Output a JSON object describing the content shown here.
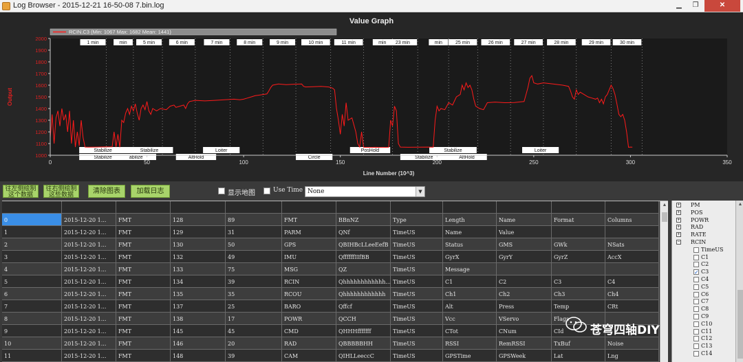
{
  "window": {
    "title": "Log Browser - 2015-12-21 16-50-08 7.bin.log",
    "min_glyph": "▁",
    "max_glyph": "❐",
    "close_glyph": "✕"
  },
  "graph": {
    "title": "Value Graph",
    "legend": "RCIN.C3 (Min: 1067 Max: 1682 Mean: 1441)",
    "ylabel": "Output",
    "xlabel": "Line Number (10^3)",
    "series_color": "#ff1a1a",
    "y_ticks": [
      "1000",
      "1100",
      "1200",
      "1300",
      "1400",
      "1500",
      "1600",
      "1700",
      "1800",
      "1900",
      "2000"
    ],
    "x_ticks": [
      "0",
      "50",
      "100",
      "150",
      "200",
      "250",
      "300",
      "350"
    ],
    "time_labels": [
      {
        "text": "1 min",
        "x": 29
      },
      {
        "text": "min",
        "x": 43
      },
      {
        "text": "5 min",
        "x": 58
      },
      {
        "text": "6 min",
        "x": 75
      },
      {
        "text": "7 min",
        "x": 93
      },
      {
        "text": "8 min",
        "x": 110
      },
      {
        "text": "9 min",
        "x": 127
      },
      {
        "text": "10 min",
        "x": 145
      },
      {
        "text": "11 min",
        "x": 162
      },
      {
        "text": "min",
        "x": 177
      },
      {
        "text": "23 min",
        "x": 190
      },
      {
        "text": "min",
        "x": 206
      },
      {
        "text": "25 min",
        "x": 221
      },
      {
        "text": "26 min",
        "x": 238
      },
      {
        "text": "27 min",
        "x": 255
      },
      {
        "text": "28 min",
        "x": 272
      },
      {
        "text": "29 min",
        "x": 290
      },
      {
        "text": "30 min",
        "x": 306
      }
    ],
    "modes_row1": [
      {
        "text": "Stabilize",
        "x": 15
      },
      {
        "text": "Stabilize",
        "x": 39
      },
      {
        "text": "Loiter",
        "x": 79
      },
      {
        "text": "PosHold",
        "x": 155
      },
      {
        "text": "Stabilize",
        "x": 196
      },
      {
        "text": "Loiter",
        "x": 244
      }
    ],
    "modes_row2": [
      {
        "text": "Stabilize",
        "x": 15
      },
      {
        "text": "abilize",
        "x": 34
      },
      {
        "text": "AltHold",
        "x": 65
      },
      {
        "text": "Circle",
        "x": 127
      },
      {
        "text": "Stabilize",
        "x": 181
      },
      {
        "text": "AltHold",
        "x": 205
      }
    ]
  },
  "chart_data": {
    "type": "line",
    "title": "Value Graph",
    "xlabel": "Line Number (10^3)",
    "ylabel": "Output",
    "xlim": [
      0,
      350
    ],
    "ylim": [
      1000,
      2000
    ],
    "grid": false,
    "legend_position": "top-left",
    "series": [
      {
        "name": "RCIN.C3 (Min: 1067 Max: 1682 Mean: 1441)",
        "color": "#ff1a1a",
        "points": [
          [
            0,
            1150
          ],
          [
            1,
            1350
          ],
          [
            2,
            1100
          ],
          [
            3,
            1320
          ],
          [
            4,
            1380
          ],
          [
            5,
            1250
          ],
          [
            6,
            1400
          ],
          [
            7,
            1300
          ],
          [
            8,
            1350
          ],
          [
            9,
            1200
          ],
          [
            10,
            1380
          ],
          [
            11,
            1100
          ],
          [
            12,
            1300
          ],
          [
            13,
            1070
          ],
          [
            14,
            1200
          ],
          [
            15,
            1080
          ],
          [
            16,
            1300
          ],
          [
            17,
            1150
          ],
          [
            18,
            1070
          ],
          [
            20,
            1069
          ],
          [
            24,
            1070
          ],
          [
            28,
            1071
          ],
          [
            32,
            1072
          ],
          [
            33,
            1200
          ],
          [
            34,
            1070
          ],
          [
            35,
            1180
          ],
          [
            36,
            1069
          ],
          [
            37,
            1300
          ],
          [
            38,
            1280
          ],
          [
            39,
            1360
          ],
          [
            40,
            1400
          ],
          [
            41,
            1350
          ],
          [
            42,
            1420
          ],
          [
            43,
            1380
          ],
          [
            44,
            1440
          ],
          [
            45,
            1360
          ],
          [
            46,
            1300
          ],
          [
            47,
            1400
          ],
          [
            48,
            1430
          ],
          [
            49,
            1390
          ],
          [
            50,
            1460
          ],
          [
            51,
            1380
          ],
          [
            52,
            1350
          ],
          [
            53,
            1400
          ],
          [
            55,
            1380
          ],
          [
            57,
            1400
          ],
          [
            60,
            1390
          ],
          [
            62,
            1420
          ],
          [
            64,
            1430
          ],
          [
            65,
            1410
          ],
          [
            67,
            1420
          ],
          [
            69,
            1430
          ],
          [
            70,
            1400
          ],
          [
            71,
            1440
          ],
          [
            72,
            1460
          ],
          [
            75,
            1470
          ],
          [
            80,
            1465
          ],
          [
            85,
            1470
          ],
          [
            90,
            1475
          ],
          [
            95,
            1480
          ],
          [
            98,
            1475
          ],
          [
            100,
            1480
          ],
          [
            102,
            1490
          ],
          [
            104,
            1500
          ],
          [
            106,
            1510
          ],
          [
            108,
            1515
          ],
          [
            110,
            1520
          ],
          [
            112,
            1525
          ],
          [
            113,
            1550
          ],
          [
            114,
            1580
          ],
          [
            115,
            1600
          ],
          [
            118,
            1610
          ],
          [
            122,
            1605
          ],
          [
            126,
            1608
          ],
          [
            130,
            1610
          ],
          [
            131,
            1590
          ],
          [
            132,
            1585
          ],
          [
            136,
            1587
          ],
          [
            140,
            1590
          ],
          [
            144,
            1585
          ],
          [
            146,
            1575
          ],
          [
            147,
            1560
          ],
          [
            148,
            1400
          ],
          [
            149,
            1300
          ],
          [
            150,
            1180
          ],
          [
            151,
            1350
          ],
          [
            152,
            1250
          ],
          [
            153,
            1450
          ],
          [
            154,
            1300
          ],
          [
            156,
            1320
          ],
          [
            158,
            1200
          ],
          [
            159,
            1100
          ],
          [
            160,
            1070
          ],
          [
            161,
            1200
          ],
          [
            162,
            1068
          ],
          [
            165,
            1067
          ],
          [
            168,
            1068
          ],
          [
            172,
            1067
          ],
          [
            175,
            1068
          ],
          [
            176,
            1300
          ],
          [
            177,
            1250
          ],
          [
            178,
            1420
          ],
          [
            179,
            1380
          ],
          [
            180,
            1100
          ],
          [
            181,
            1070
          ],
          [
            185,
            1068
          ],
          [
            190,
            1069
          ],
          [
            195,
            1070
          ],
          [
            198,
            1069
          ],
          [
            199,
            1300
          ],
          [
            200,
            1420
          ],
          [
            201,
            1380
          ],
          [
            202,
            1400
          ],
          [
            204,
            1390
          ],
          [
            206,
            1450
          ],
          [
            208,
            1430
          ],
          [
            210,
            1500
          ],
          [
            212,
            1520
          ],
          [
            213,
            1600
          ],
          [
            214,
            1560
          ],
          [
            215,
            1620
          ],
          [
            216,
            1580
          ],
          [
            217,
            1600
          ],
          [
            218,
            1560
          ],
          [
            219,
            1480
          ],
          [
            220,
            1420
          ],
          [
            222,
            1400
          ],
          [
            224,
            1390
          ],
          [
            225,
            1420
          ],
          [
            226,
            1450
          ],
          [
            230,
            1455
          ],
          [
            235,
            1450
          ],
          [
            240,
            1452
          ],
          [
            242,
            1455
          ],
          [
            245,
            1460
          ],
          [
            246,
            1520
          ],
          [
            247,
            1580
          ],
          [
            248,
            1660
          ],
          [
            249,
            1682
          ],
          [
            250,
            1620
          ],
          [
            252,
            1610
          ],
          [
            255,
            1620
          ],
          [
            260,
            1610
          ],
          [
            265,
            1600
          ],
          [
            268,
            1590
          ],
          [
            269,
            1550
          ],
          [
            270,
            1500
          ],
          [
            271,
            1480
          ],
          [
            272,
            1560
          ],
          [
            273,
            1520
          ],
          [
            274,
            1540
          ],
          [
            276,
            1520
          ],
          [
            278,
            1500
          ],
          [
            280,
            1490
          ],
          [
            282,
            1480
          ],
          [
            283,
            1490
          ],
          [
            284,
            1450
          ],
          [
            285,
            1480
          ],
          [
            286,
            1440
          ],
          [
            287,
            1500
          ],
          [
            288,
            1520
          ],
          [
            290,
            1600
          ],
          [
            291,
            1570
          ],
          [
            292,
            1520
          ],
          [
            293,
            1440
          ],
          [
            294,
            1350
          ],
          [
            295,
            1330
          ],
          [
            296,
            1350
          ],
          [
            297,
            1300
          ],
          [
            298,
            1200
          ],
          [
            299,
            1068
          ],
          [
            300,
            1070
          ],
          [
            301,
            1069
          ]
        ]
      }
    ]
  },
  "toolbar": {
    "btn1_line1": "往左侧绘制",
    "btn1_line2": "这个数据",
    "btn2_line1": "往右侧绘制",
    "btn2_line2": "这些数据",
    "clear_label": "清除图表",
    "load_label": "加载日志",
    "show_map_label": "显示地图",
    "use_time_label": "Use Time",
    "select_value": "None"
  },
  "table": {
    "rows": [
      [
        "0",
        "2015-12-20 1...",
        "FMT",
        "128",
        "89",
        "FMT",
        "BBnNZ",
        "Type",
        "Length",
        "Name",
        "Format",
        "Columns"
      ],
      [
        "1",
        "2015-12-20 1...",
        "FMT",
        "129",
        "31",
        "PARM",
        "QNf",
        "TimeUS",
        "Name",
        "Value",
        "",
        ""
      ],
      [
        "2",
        "2015-12-20 1...",
        "FMT",
        "130",
        "50",
        "GPS",
        "QBIHBcLLeeEefB",
        "TimeUS",
        "Status",
        "GMS",
        "GWk",
        "NSats"
      ],
      [
        "3",
        "2015-12-20 1...",
        "FMT",
        "132",
        "49",
        "IMU",
        "QffffffIIfBB",
        "TimeUS",
        "GyrX",
        "GyrY",
        "GyrZ",
        "AccX"
      ],
      [
        "4",
        "2015-12-20 1...",
        "FMT",
        "133",
        "75",
        "MSG",
        "QZ",
        "TimeUS",
        "Message",
        "",
        "",
        ""
      ],
      [
        "5",
        "2015-12-20 1...",
        "FMT",
        "134",
        "39",
        "RCIN",
        "Qhhhhhhhhhhhh...",
        "TimeUS",
        "C1",
        "C2",
        "C3",
        "C4"
      ],
      [
        "6",
        "2015-12-20 1...",
        "FMT",
        "135",
        "35",
        "RCOU",
        "Qhhhhhhhhhhhh",
        "TimeUS",
        "Ch1",
        "Ch2",
        "Ch3",
        "Ch4"
      ],
      [
        "7",
        "2015-12-20 1...",
        "FMT",
        "137",
        "25",
        "BARO",
        "Qffcf",
        "TimeUS",
        "Alt",
        "Press",
        "Temp",
        "CRt"
      ],
      [
        "8",
        "2015-12-20 1...",
        "FMT",
        "138",
        "17",
        "POWR",
        "QCCH",
        "TimeUS",
        "Vcc",
        "VServo",
        "Flags",
        ""
      ],
      [
        "9",
        "2015-12-20 1...",
        "FMT",
        "145",
        "45",
        "CMD",
        "QHHHfffffff",
        "TimeUS",
        "CTot",
        "CNum",
        "CId",
        ""
      ],
      [
        "10",
        "2015-12-20 1...",
        "FMT",
        "146",
        "20",
        "RAD",
        "QBBBBBHH",
        "TimeUS",
        "RSSI",
        "RemRSSI",
        "TxBuf",
        "Noise"
      ],
      [
        "11",
        "2015-12-20 1...",
        "FMT",
        "148",
        "39",
        "CAM",
        "QIHLLeeccC",
        "TimeUS",
        "GPSTime",
        "GPSWeek",
        "Lat",
        "Lng"
      ]
    ]
  },
  "tree": {
    "nodes": [
      {
        "label": "PM",
        "type": "group",
        "mark": "+"
      },
      {
        "label": "POS",
        "type": "group",
        "mark": "+"
      },
      {
        "label": "POWR",
        "type": "group",
        "mark": "+"
      },
      {
        "label": "RAD",
        "type": "group",
        "mark": "+"
      },
      {
        "label": "RATE",
        "type": "group",
        "mark": "+"
      },
      {
        "label": "RCIN",
        "type": "group",
        "mark": "−"
      },
      {
        "label": "TimeUS",
        "type": "leaf",
        "checked": ""
      },
      {
        "label": "C1",
        "type": "leaf",
        "checked": ""
      },
      {
        "label": "C2",
        "type": "leaf",
        "checked": ""
      },
      {
        "label": "C3",
        "type": "leaf",
        "checked": "✓"
      },
      {
        "label": "C4",
        "type": "leaf",
        "checked": ""
      },
      {
        "label": "C5",
        "type": "leaf",
        "checked": ""
      },
      {
        "label": "C6",
        "type": "leaf",
        "checked": ""
      },
      {
        "label": "C7",
        "type": "leaf",
        "checked": ""
      },
      {
        "label": "C8",
        "type": "leaf",
        "checked": ""
      },
      {
        "label": "C9",
        "type": "leaf",
        "checked": ""
      },
      {
        "label": "C10",
        "type": "leaf",
        "checked": ""
      },
      {
        "label": "C11",
        "type": "leaf",
        "checked": ""
      },
      {
        "label": "C12",
        "type": "leaf",
        "checked": ""
      },
      {
        "label": "C13",
        "type": "leaf",
        "checked": ""
      },
      {
        "label": "C14",
        "type": "leaf",
        "checked": ""
      }
    ]
  },
  "watermark": {
    "text": "苍穹四轴DIY",
    "icon": "wechat-icon"
  }
}
